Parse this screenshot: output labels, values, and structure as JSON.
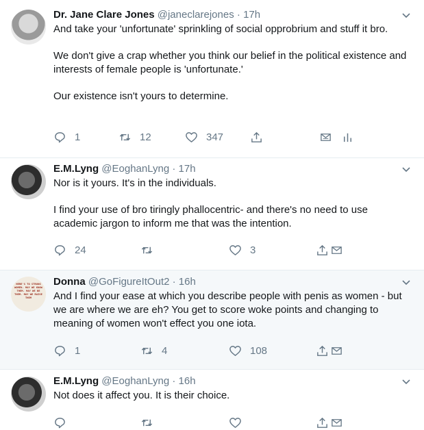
{
  "tweets": [
    {
      "name": "Dr. Jane Clare Jones",
      "handle": "@janeclarejones",
      "dot": "·",
      "time": "17h",
      "paragraphs": [
        "And take your 'unfortunate' sprinkling of social opprobrium and stuff it bro.",
        "We don't give a crap whether you think our belief in the political existence and interests of female people is 'unfortunate.'",
        "Our existence isn't yours to determine."
      ],
      "replies": "1",
      "retweets": "12",
      "likes": "347",
      "icons": [
        "reply-icon",
        "retweet-icon",
        "like-icon",
        "share-icon",
        "inbox-icon",
        "analytics-icon"
      ]
    },
    {
      "name": "E.M.Lyng",
      "handle": "@EoghanLyng",
      "dot": "·",
      "time": "17h",
      "paragraphs": [
        "Nor is it yours. It's in the individuals.",
        "I find your use of bro tiringly phallocentric- and there's no need to use academic jargon to inform me that was the intention."
      ],
      "replies": "24",
      "retweets": "",
      "likes": "3",
      "icons": [
        "reply-icon",
        "retweet-icon",
        "like-icon",
        "share-icon",
        "inbox-icon"
      ]
    },
    {
      "name": "Donna",
      "handle": "@GoFigureItOut2",
      "dot": "·",
      "time": "16h",
      "avatar_text": "HERE'S TO STRONG WOMEN. MAY WE KNOW THEM. MAY WE BE THEM. MAY WE RAISE THEM",
      "paragraphs": [
        "And I find your ease at which you describe people with penis as women - but we are where we are eh? You get to  score woke points and changing to meaning of women won't effect you one iota."
      ],
      "replies": "1",
      "retweets": "4",
      "likes": "108",
      "icons": [
        "reply-icon",
        "retweet-icon",
        "like-icon",
        "share-icon",
        "inbox-icon"
      ]
    },
    {
      "name": "E.M.Lyng",
      "handle": "@EoghanLyng",
      "dot": "·",
      "time": "16h",
      "paragraphs": [
        "Not does it affect you. It is their choice."
      ],
      "icons": [
        "reply-icon",
        "retweet-icon",
        "like-icon",
        "share-icon",
        "inbox-icon"
      ]
    }
  ],
  "colors": {
    "text": "#14171a",
    "muted": "#657786",
    "highlight_bg": "#f5f8fa",
    "border": "#e6ecf0"
  }
}
